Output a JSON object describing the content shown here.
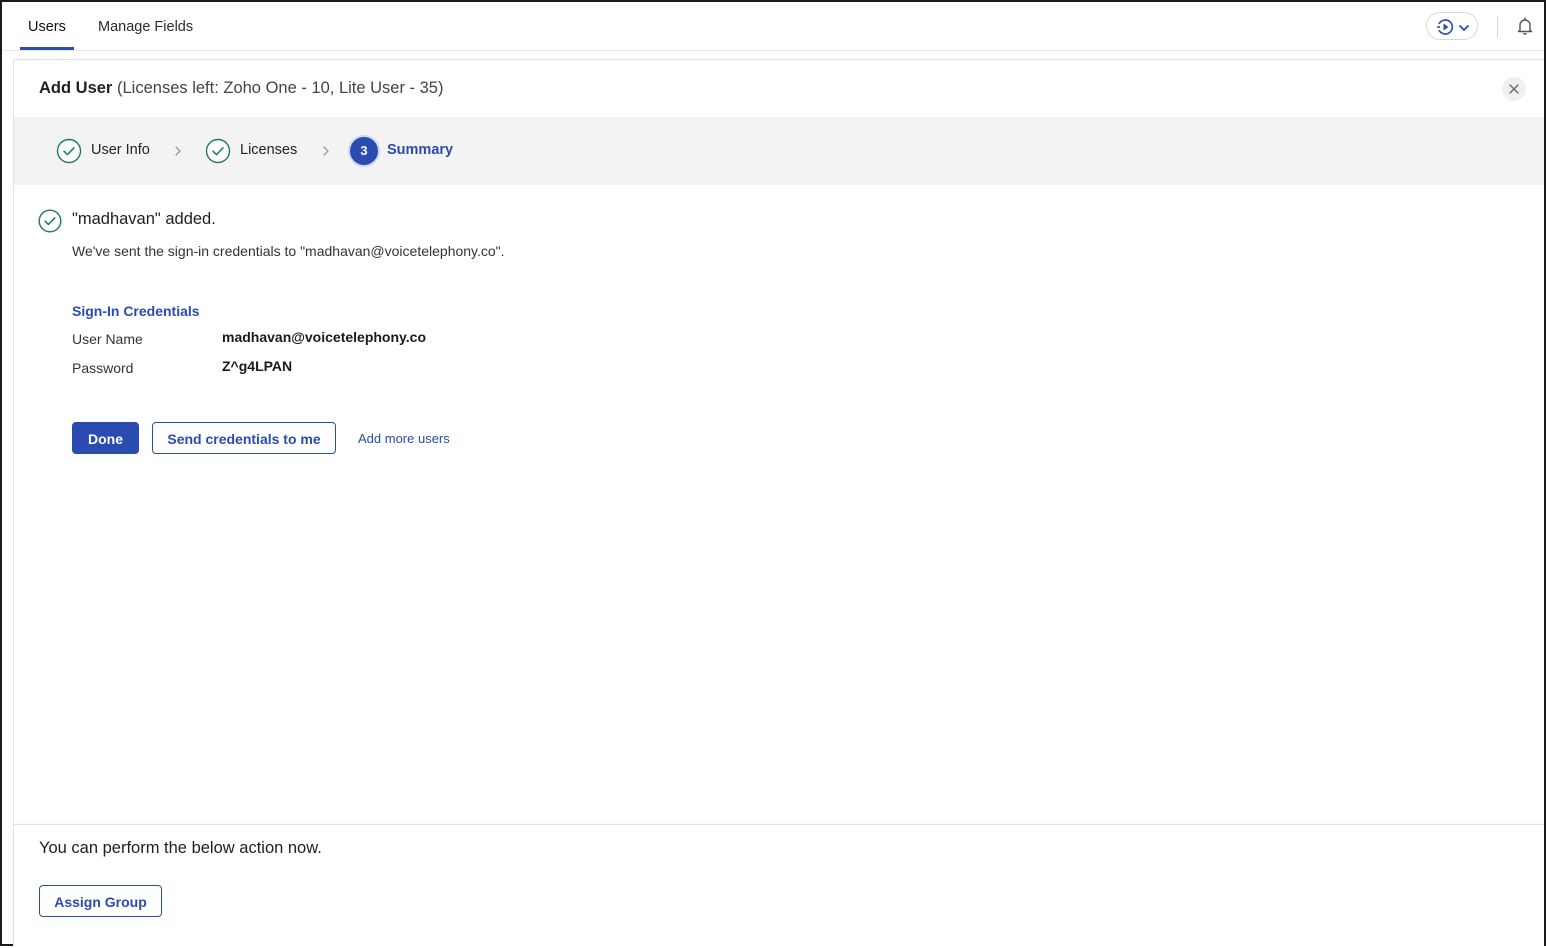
{
  "nav": {
    "tabs": [
      {
        "label": "Users",
        "active": true
      },
      {
        "label": "Manage Fields",
        "active": false
      }
    ],
    "icons": {
      "play_menu": "play-circle-icon",
      "chevron": "chevron-down-icon",
      "bell": "bell-icon"
    }
  },
  "panel": {
    "title": "Add User",
    "subtitle": "(Licenses left: Zoho One - 10, Lite User - 35)"
  },
  "stepper": {
    "steps": [
      {
        "label": "User Info",
        "state": "complete"
      },
      {
        "label": "Licenses",
        "state": "complete"
      },
      {
        "label": "Summary",
        "state": "current",
        "number": "3"
      }
    ]
  },
  "result": {
    "title": "\"madhavan\" added.",
    "description": "We've sent the sign-in credentials to \"madhavan@voicetelephony.co\"."
  },
  "credentials": {
    "heading": "Sign-In Credentials",
    "username_label": "User Name",
    "username_value": "madhavan@voicetelephony.co",
    "password_label": "Password",
    "password_value": "Z^g4LPAN"
  },
  "actions": {
    "done": "Done",
    "send": "Send credentials to me",
    "add_more": "Add more users"
  },
  "footer": {
    "text": "You can perform the below action now.",
    "assign_group": "Assign Group"
  },
  "colors": {
    "accent": "#2a4bb0",
    "success": "#1e7d4f",
    "stepper_bg": "#f3f3f3"
  }
}
